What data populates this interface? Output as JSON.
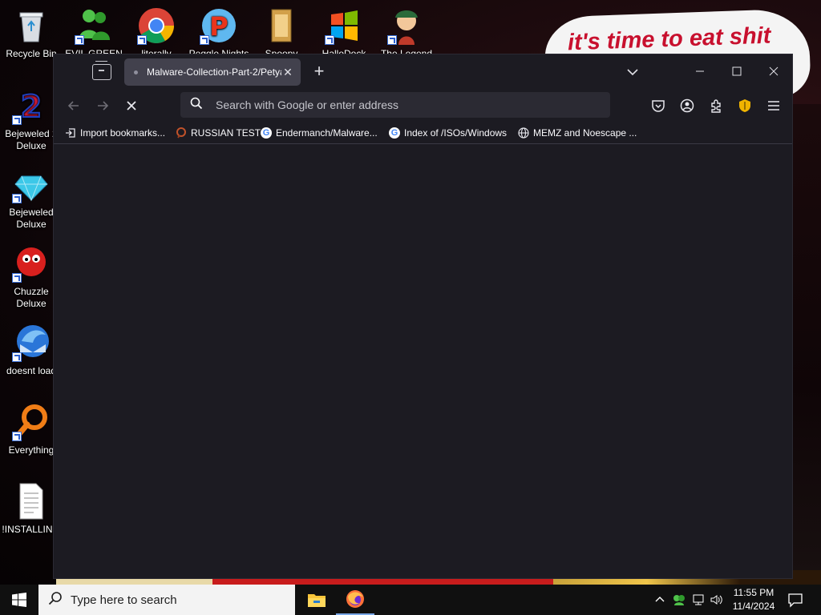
{
  "wallpaper": {
    "bubble_text": "it's time to eat shit"
  },
  "desktop_icons": [
    {
      "label": "Recycle Bin",
      "icon": "recycle-bin-icon"
    },
    {
      "label": "Bejeweled 2 Deluxe",
      "icon": "bejeweled2-icon"
    },
    {
      "label": "Bejeweled Deluxe",
      "icon": "bejeweled-icon"
    },
    {
      "label": "Chuzzle Deluxe",
      "icon": "chuzzle-icon"
    },
    {
      "label": "doesnt load",
      "icon": "thunderbird-icon"
    },
    {
      "label": "Everything",
      "icon": "everything-icon"
    },
    {
      "label": "!INSTALLIN...",
      "icon": "text-file-icon"
    },
    {
      "label": "EVIL GREEN",
      "icon": "msn-icon"
    },
    {
      "label": "literally",
      "icon": "chrome-icon"
    },
    {
      "label": "Peggle Nights",
      "icon": "peggle-icon"
    },
    {
      "label": "Spoopy",
      "icon": "spoopy-icon"
    },
    {
      "label": "HalloDock",
      "icon": "windows-logo-icon"
    },
    {
      "label": "The Legend",
      "icon": "legend-icon"
    }
  ],
  "browser": {
    "tab": {
      "title": "Malware-Collection-Part-2/Petya"
    },
    "urlbar": {
      "placeholder": "Search with Google or enter address"
    },
    "bookmarks": [
      {
        "label": "Import bookmarks...",
        "icon": "import-icon"
      },
      {
        "label": "RUSSIAN TEST",
        "icon": "russian-test-icon"
      },
      {
        "label": "Endermanch/Malware...",
        "icon": "google-icon"
      },
      {
        "label": "Index of /ISOs/Windows",
        "icon": "google-icon"
      },
      {
        "label": "MEMZ and Noescape ...",
        "icon": "globe-icon"
      }
    ]
  },
  "taskbar": {
    "search_placeholder": "Type here to search",
    "time": "11:55 PM",
    "date": "11/4/2024"
  },
  "colors": {
    "browser_bg": "#1c1b22",
    "tab_active": "#42414d",
    "bubble_text": "#c8102e"
  }
}
